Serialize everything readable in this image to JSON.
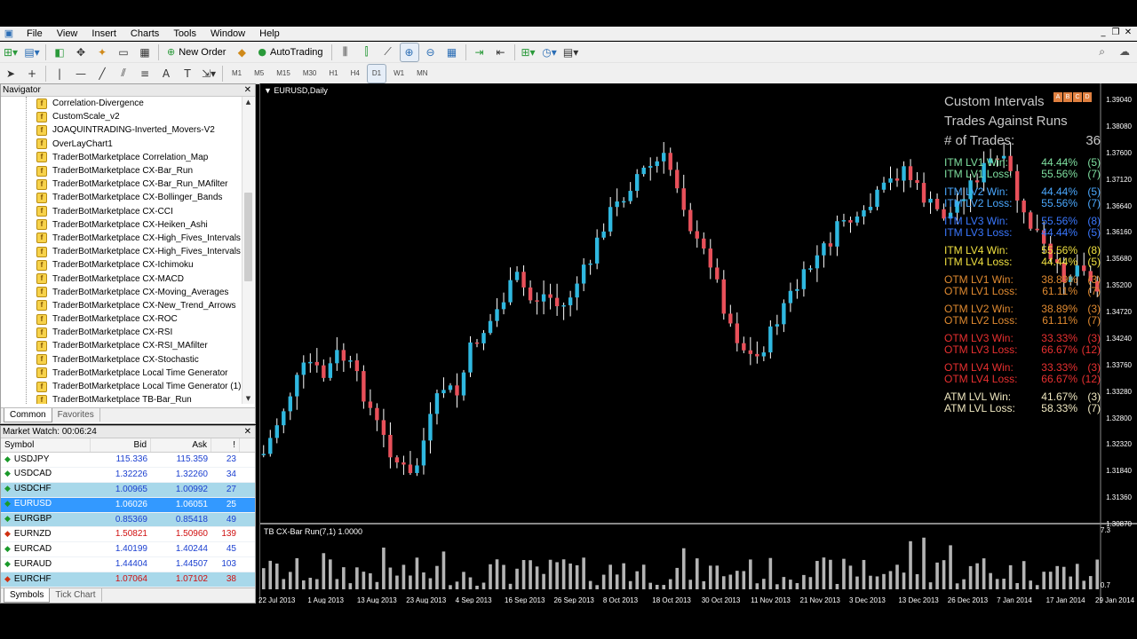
{
  "menu": [
    "File",
    "View",
    "Insert",
    "Charts",
    "Tools",
    "Window",
    "Help"
  ],
  "toolbar": {
    "new_order": "New Order",
    "autotrading": "AutoTrading",
    "timeframes": [
      "M1",
      "M5",
      "M15",
      "M30",
      "H1",
      "H4",
      "D1",
      "W1",
      "MN"
    ]
  },
  "navigator": {
    "title": "Navigator",
    "items": [
      "Correlation-Divergence",
      "CustomScale_v2",
      "JOAQUINTRADING-Inverted_Movers-V2",
      "OverLayChart1",
      "TraderBotMarketplace Correlation_Map",
      "TraderBotMarketplace CX-Bar_Run",
      "TraderBotMarketplace CX-Bar_Run_MAfilter",
      "TraderBotMarketplace CX-Bollinger_Bands",
      "TraderBotMarketplace CX-CCI",
      "TraderBotMarketplace CX-Heiken_Ashi",
      "TraderBotMarketplace CX-High_Fives_Intervals",
      "TraderBotMarketplace CX-High_Fives_Intervals",
      "TraderBotMarketplace CX-Ichimoku",
      "TraderBotMarketplace CX-MACD",
      "TraderBotMarketplace CX-Moving_Averages",
      "TraderBotMarketplace CX-New_Trend_Arrows",
      "TraderBotMarketplace CX-ROC",
      "TraderBotMarketplace CX-RSI",
      "TraderBotMarketplace CX-RSI_MAfilter",
      "TraderBotMarketplace CX-Stochastic",
      "TraderBotMarketplace Local Time Generator",
      "TraderBotMarketplace Local Time Generator (1)",
      "TraderBotMarketplace TB-Bar_Run"
    ],
    "tabs": [
      "Common",
      "Favorites"
    ]
  },
  "market_watch": {
    "title": "Market Watch: 00:06:24",
    "columns": [
      "Symbol",
      "Bid",
      "Ask",
      "!"
    ],
    "rows": [
      {
        "symbol": "USDJPY",
        "bid": "115.336",
        "ask": "115.359",
        "spread": "23",
        "dir": "up",
        "color": "blue",
        "state": ""
      },
      {
        "symbol": "USDCAD",
        "bid": "1.32226",
        "ask": "1.32260",
        "spread": "34",
        "dir": "up",
        "color": "blue",
        "state": ""
      },
      {
        "symbol": "USDCHF",
        "bid": "1.00965",
        "ask": "1.00992",
        "spread": "27",
        "dir": "up",
        "color": "blue",
        "state": "hl"
      },
      {
        "symbol": "EURUSD",
        "bid": "1.06026",
        "ask": "1.06051",
        "spread": "25",
        "dir": "up",
        "color": "blue",
        "state": "sel"
      },
      {
        "symbol": "EURGBP",
        "bid": "0.85369",
        "ask": "0.85418",
        "spread": "49",
        "dir": "up",
        "color": "blue",
        "state": "hl"
      },
      {
        "symbol": "EURNZD",
        "bid": "1.50821",
        "ask": "1.50960",
        "spread": "139",
        "dir": "down",
        "color": "red",
        "state": ""
      },
      {
        "symbol": "EURCAD",
        "bid": "1.40199",
        "ask": "1.40244",
        "spread": "45",
        "dir": "up",
        "color": "blue",
        "state": ""
      },
      {
        "symbol": "EURAUD",
        "bid": "1.44404",
        "ask": "1.44507",
        "spread": "103",
        "dir": "up",
        "color": "blue",
        "state": ""
      },
      {
        "symbol": "EURCHF",
        "bid": "1.07064",
        "ask": "1.07102",
        "spread": "38",
        "dir": "down",
        "color": "red",
        "state": "hl"
      }
    ],
    "tabs": [
      "Symbols",
      "Tick Chart"
    ]
  },
  "chart": {
    "title": "EURUSD,Daily",
    "indicator_title": "TB CX-Bar Run(7,1) 1.0000",
    "price_labels": [
      "1.39040",
      "1.38080",
      "1.37600",
      "1.37120",
      "1.36640",
      "1.36160",
      "1.35680",
      "1.35200",
      "1.34720",
      "1.34240",
      "1.33760",
      "1.33280",
      "1.32800",
      "1.32320",
      "1.31840",
      "1.31360",
      "1.30870"
    ],
    "indicator_labels": [
      "7.3",
      "0.7"
    ],
    "date_labels": [
      "22 Jul 2013",
      "1 Aug 2013",
      "13 Aug 2013",
      "23 Aug 2013",
      "4 Sep 2013",
      "16 Sep 2013",
      "26 Sep 2013",
      "8 Oct 2013",
      "18 Oct 2013",
      "30 Oct 2013",
      "11 Nov 2013",
      "21 Nov 2013",
      "3 Dec 2013",
      "13 Dec 2013",
      "26 Dec 2013",
      "7 Jan 2014",
      "17 Jan 2014",
      "29 Jan 2014"
    ],
    "abcd": [
      "A",
      "B",
      "C",
      "D"
    ],
    "colors": {
      "bull": "#2fb8e0",
      "bear": "#e8505a",
      "histogram": "#b4b4b4"
    }
  },
  "stats": {
    "title1": "Custom Intervals",
    "title2": "Trades Against Runs",
    "trades_label": "# of Trades:",
    "trades_value": "36",
    "groups": [
      {
        "color": "#7fe0a0",
        "rows": [
          {
            "label": "ITM LV1 Win:",
            "pct": "44.44%",
            "cnt": "(5)"
          },
          {
            "label": "ITM LV1 Loss:",
            "pct": "55.56%",
            "cnt": "(7)"
          }
        ]
      },
      {
        "color": "#4aa8ff",
        "rows": [
          {
            "label": "ITM LV2 Win:",
            "pct": "44.44%",
            "cnt": "(5)"
          },
          {
            "label": "ITM LV2 Loss:",
            "pct": "55.56%",
            "cnt": "(7)"
          }
        ]
      },
      {
        "color": "#3a78ff",
        "rows": [
          {
            "label": "ITM LV3 Win:",
            "pct": "55.56%",
            "cnt": "(8)"
          },
          {
            "label": "ITM LV3 Loss:",
            "pct": "44.44%",
            "cnt": "(5)"
          }
        ]
      },
      {
        "color": "#f0e040",
        "rows": [
          {
            "label": "ITM LV4 Win:",
            "pct": "55.56%",
            "cnt": "(8)"
          },
          {
            "label": "ITM LV4 Loss:",
            "pct": "44.44%",
            "cnt": "(5)"
          }
        ]
      },
      {
        "color": "#e08a30",
        "rows": [
          {
            "label": "OTM LV1 Win:",
            "pct": "38.89%",
            "cnt": "(3)"
          },
          {
            "label": "OTM LV1 Loss:",
            "pct": "61.11%",
            "cnt": "(7)"
          }
        ]
      },
      {
        "color": "#e08a30",
        "rows": [
          {
            "label": "OTM LV2 Win:",
            "pct": "38.89%",
            "cnt": "(3)"
          },
          {
            "label": "OTM LV2 Loss:",
            "pct": "61.11%",
            "cnt": "(7)"
          }
        ]
      },
      {
        "color": "#e83030",
        "rows": [
          {
            "label": "OTM LV3 Win:",
            "pct": "33.33%",
            "cnt": "(3)"
          },
          {
            "label": "OTM LV3 Loss:",
            "pct": "66.67%",
            "cnt": "(12)"
          }
        ]
      },
      {
        "color": "#e83030",
        "rows": [
          {
            "label": "OTM LV4 Win:",
            "pct": "33.33%",
            "cnt": "(3)"
          },
          {
            "label": "OTM LV4 Loss:",
            "pct": "66.67%",
            "cnt": "(12)"
          }
        ]
      },
      {
        "color": "#f0e8c0",
        "rows": [
          {
            "label": "ATM LVL Win:",
            "pct": "41.67%",
            "cnt": "(3)"
          },
          {
            "label": "ATM LVL Loss:",
            "pct": "58.33%",
            "cnt": "(7)"
          }
        ]
      }
    ]
  }
}
